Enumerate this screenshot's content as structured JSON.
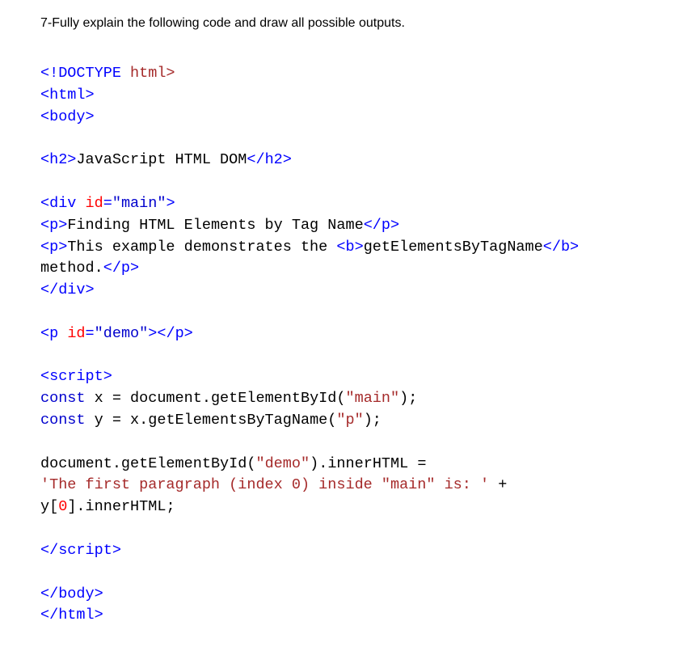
{
  "question": "7-Fully explain the following code and draw all possible outputs.",
  "code": {
    "l1": {
      "a": "<!DOCTYPE",
      "b": " html>"
    },
    "l2": {
      "a": "<html>"
    },
    "l3": {
      "a": "<body>"
    },
    "l5": {
      "a": "<h2>",
      "b": "JavaScript HTML DOM",
      "c": "</h2>"
    },
    "l7": {
      "a": "<div",
      "b": " id",
      "c": "=",
      "d": "\"main\"",
      "e": ">"
    },
    "l8": {
      "a": "<p>",
      "b": "Finding HTML Elements by Tag Name",
      "c": "</p>"
    },
    "l9": {
      "a": "<p>",
      "b": "This example demonstrates the ",
      "c": "<b>",
      "d": "getElementsByTagName",
      "e": "</b>"
    },
    "l9b": {
      "a": "method.",
      "b": "</p>"
    },
    "l10": {
      "a": "</div>"
    },
    "l12": {
      "a": "<p",
      "b": " id",
      "c": "=",
      "d": "\"demo\"",
      "e": "></p>"
    },
    "l14": {
      "a": "<script>"
    },
    "l15": {
      "a": "const",
      "b": " x = document.",
      "c": "getElementById",
      "d": "(",
      "e": "\"main\"",
      "f": ");"
    },
    "l16": {
      "a": "const",
      "b": " y = x.",
      "c": "getElementsByTagName",
      "d": "(",
      "e": "\"p\"",
      "f": ");"
    },
    "l18": {
      "a": "document.",
      "b": "getElementById",
      "c": "(",
      "d": "\"demo\"",
      "e": ").",
      "f": "innerHTML",
      "g": " ="
    },
    "l19": {
      "a": "'The first paragraph (index 0) inside \"main\" is: '",
      "b": " +"
    },
    "l20": {
      "a": "y[",
      "b": "0",
      "c": "].",
      "d": "innerHTML",
      "e": ";"
    },
    "l22": {
      "a": "</script>"
    },
    "l24": {
      "a": "</body>"
    },
    "l25": {
      "a": "</html>"
    }
  }
}
